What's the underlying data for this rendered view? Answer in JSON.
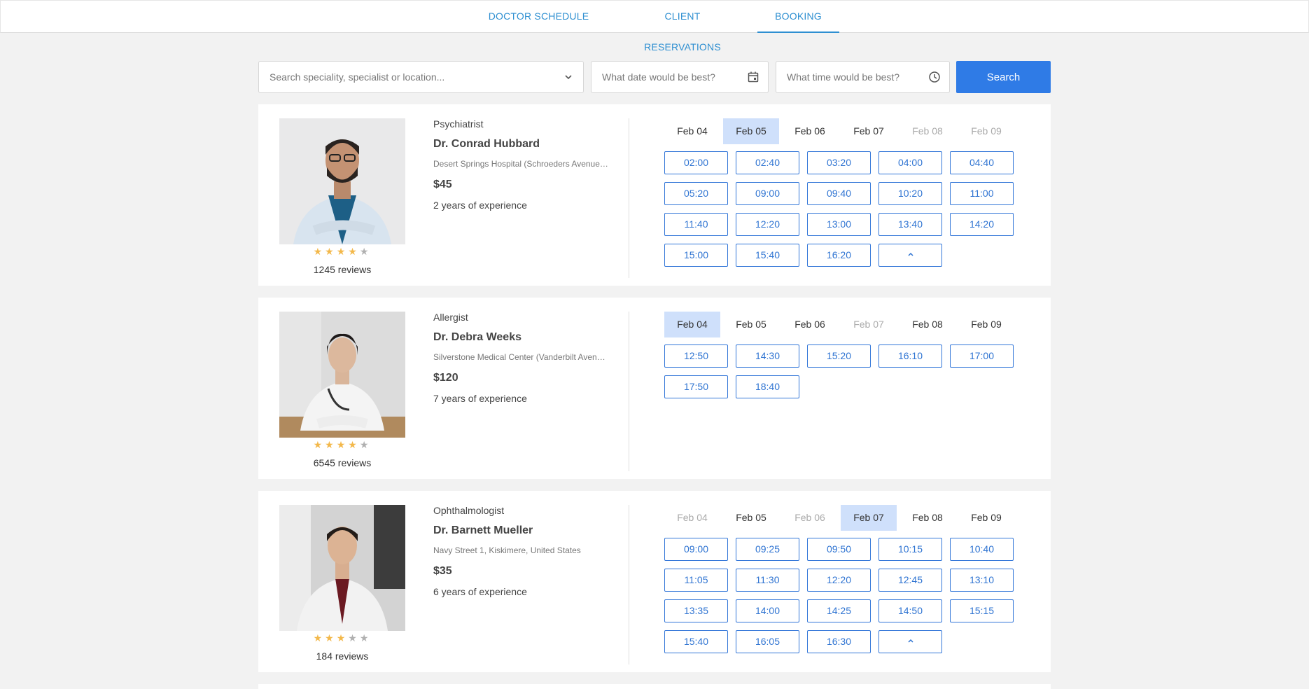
{
  "nav": {
    "tabs": [
      {
        "label": "DOCTOR SCHEDULE"
      },
      {
        "label": "CLIENT RESERVATIONS"
      },
      {
        "label": "BOOKING"
      }
    ],
    "active_tab": "BOOKING"
  },
  "search": {
    "specialty_placeholder": "Search speciality, specialist or location...",
    "date_placeholder": "What date would be best?",
    "time_placeholder": "What time would be best?",
    "button_label": "Search"
  },
  "colors": {
    "accent": "#2f7be6",
    "selected_date": "#cfe0fb",
    "star": "#f3b84a"
  },
  "doctors": [
    {
      "specialty": "Psychiatrist",
      "name": "Dr. Conrad Hubbard",
      "address": "Desert Springs Hospital (Schroeders Avenue ...",
      "price": "$45",
      "experience": "2 years of experience",
      "rating": 4,
      "reviews": "1245 reviews",
      "dates": [
        {
          "label": "Feb 04",
          "state": "normal"
        },
        {
          "label": "Feb 05",
          "state": "selected"
        },
        {
          "label": "Feb 06",
          "state": "normal"
        },
        {
          "label": "Feb 07",
          "state": "normal"
        },
        {
          "label": "Feb 08",
          "state": "disabled"
        },
        {
          "label": "Feb 09",
          "state": "disabled"
        }
      ],
      "slots": [
        "02:00",
        "02:40",
        "03:20",
        "04:00",
        "04:40",
        "05:20",
        "09:00",
        "09:40",
        "10:20",
        "11:00",
        "11:40",
        "12:20",
        "13:00",
        "13:40",
        "14:20",
        "15:00",
        "15:40",
        "16:20"
      ],
      "collapse_icon": "chevron-up-icon"
    },
    {
      "specialty": "Allergist",
      "name": "Dr. Debra Weeks",
      "address": "Silverstone Medical Center (Vanderbilt Avenu...",
      "price": "$120",
      "experience": "7 years of experience",
      "rating": 4,
      "reviews": "6545 reviews",
      "dates": [
        {
          "label": "Feb 04",
          "state": "selected"
        },
        {
          "label": "Feb 05",
          "state": "normal"
        },
        {
          "label": "Feb 06",
          "state": "normal"
        },
        {
          "label": "Feb 07",
          "state": "disabled"
        },
        {
          "label": "Feb 08",
          "state": "normal"
        },
        {
          "label": "Feb 09",
          "state": "normal"
        }
      ],
      "slots": [
        "12:50",
        "14:30",
        "15:20",
        "16:10",
        "17:00",
        "17:50",
        "18:40"
      ],
      "collapse_icon": null
    },
    {
      "specialty": "Ophthalmologist",
      "name": "Dr. Barnett Mueller",
      "address": "Navy Street 1, Kiskimere, United States",
      "price": "$35",
      "experience": "6 years of experience",
      "rating": 3,
      "reviews": "184 reviews",
      "dates": [
        {
          "label": "Feb 04",
          "state": "disabled"
        },
        {
          "label": "Feb 05",
          "state": "normal"
        },
        {
          "label": "Feb 06",
          "state": "disabled"
        },
        {
          "label": "Feb 07",
          "state": "selected"
        },
        {
          "label": "Feb 08",
          "state": "normal"
        },
        {
          "label": "Feb 09",
          "state": "normal"
        }
      ],
      "slots": [
        "09:00",
        "09:25",
        "09:50",
        "10:15",
        "10:40",
        "11:05",
        "11:30",
        "12:20",
        "12:45",
        "13:10",
        "13:35",
        "14:00",
        "14:25",
        "14:50",
        "15:15",
        "15:40",
        "16:05",
        "16:30"
      ],
      "collapse_icon": "chevron-up-icon"
    }
  ]
}
